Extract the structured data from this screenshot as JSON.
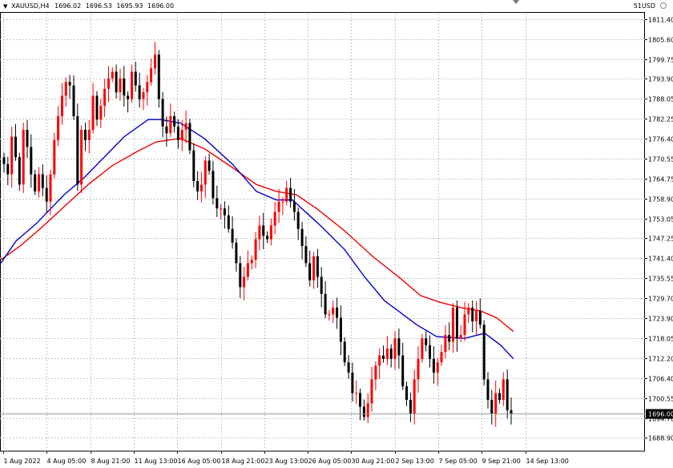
{
  "header": {
    "symbol": "XAUUSD,H4",
    "open": "1696.02",
    "high": "1696.53",
    "low": "1695.93",
    "close": "1696.00",
    "signal": "51USD"
  },
  "colors": {
    "bull": "#ff0000",
    "bear": "#000000",
    "ma_fast": "#0000cc",
    "ma_slow": "#ee0000",
    "grid": "#c8c8c8",
    "price_tag_bg": "#000000",
    "price_tag_fg": "#ffffff"
  },
  "chart_data": {
    "type": "candlestick",
    "timeframe": "H4",
    "ylim": [
      1685,
      1813
    ],
    "grid": true,
    "price_ticks": [
      "1811.40",
      "1805.60",
      "1799.75",
      "1793.90",
      "1788.05",
      "1782.25",
      "1776.40",
      "1770.55",
      "1764.75",
      "1758.90",
      "1753.05",
      "1747.25",
      "1741.40",
      "1735.55",
      "1729.70",
      "1723.90",
      "1718.05",
      "1712.20",
      "1706.40",
      "1700.55",
      "1694.70",
      "1688.90"
    ],
    "time_labels": [
      "1 Aug 2022",
      "4 Aug 05:00",
      "8 Aug 21:00",
      "11 Aug 13:00",
      "16 Aug 05:00",
      "18 Aug 21:00",
      "23 Aug 13:00",
      "26 Aug 05:00",
      "30 Aug 21:00",
      "2 Sep 13:00",
      "7 Sep 05:00",
      "9 Sep 21:00",
      "14 Sep 13:00"
    ],
    "current_price": "1696.00",
    "closes": [
      1769,
      1766,
      1777,
      1771,
      1763,
      1779,
      1774,
      1766,
      1761,
      1766,
      1762,
      1758,
      1766,
      1776,
      1783,
      1789,
      1793,
      1792,
      1783,
      1763,
      1779,
      1776,
      1779,
      1789,
      1782,
      1786,
      1791,
      1794,
      1796,
      1790,
      1794,
      1789,
      1788,
      1796,
      1792,
      1788,
      1790,
      1793,
      1797,
      1801,
      1788,
      1780,
      1778,
      1783,
      1780,
      1776,
      1779,
      1781,
      1773,
      1764,
      1761,
      1763,
      1770,
      1767,
      1759,
      1756,
      1756,
      1754,
      1750,
      1746,
      1740,
      1733,
      1736,
      1740,
      1741,
      1747,
      1751,
      1748,
      1747,
      1751,
      1755,
      1758,
      1758,
      1762,
      1758,
      1755,
      1750,
      1745,
      1740,
      1735,
      1742,
      1736,
      1731,
      1725,
      1725,
      1727,
      1724,
      1717,
      1711,
      1708,
      1702,
      1702,
      1698,
      1695,
      1699,
      1706,
      1710,
      1713,
      1712,
      1715,
      1712,
      1718,
      1713,
      1704,
      1700,
      1696,
      1706,
      1712,
      1718,
      1716,
      1712,
      1708,
      1711,
      1714,
      1719,
      1717,
      1727,
      1718,
      1719,
      1725,
      1727,
      1723,
      1726,
      1722,
      1706,
      1700,
      1696,
      1702,
      1700,
      1706,
      1697,
      1696
    ],
    "ma_fast": [
      {
        "x": 1,
        "y": 1740
      },
      {
        "x": 20,
        "y": 1746.5
      },
      {
        "x": 45,
        "y": 1751.5
      },
      {
        "x": 80,
        "y": 1760
      },
      {
        "x": 105,
        "y": 1765
      },
      {
        "x": 130,
        "y": 1771
      },
      {
        "x": 155,
        "y": 1777
      },
      {
        "x": 185,
        "y": 1782
      },
      {
        "x": 200,
        "y": 1782
      },
      {
        "x": 225,
        "y": 1781
      },
      {
        "x": 255,
        "y": 1776.5
      },
      {
        "x": 290,
        "y": 1769
      },
      {
        "x": 320,
        "y": 1761
      },
      {
        "x": 345,
        "y": 1758.5
      },
      {
        "x": 365,
        "y": 1758.5
      },
      {
        "x": 400,
        "y": 1751
      },
      {
        "x": 430,
        "y": 1744
      },
      {
        "x": 455,
        "y": 1736
      },
      {
        "x": 480,
        "y": 1729
      },
      {
        "x": 500,
        "y": 1725.5
      },
      {
        "x": 520,
        "y": 1722
      },
      {
        "x": 545,
        "y": 1718.5
      },
      {
        "x": 580,
        "y": 1718
      },
      {
        "x": 605,
        "y": 1719.5
      },
      {
        "x": 625,
        "y": 1716
      },
      {
        "x": 641,
        "y": 1712
      }
    ],
    "ma_slow": [
      {
        "x": 1,
        "y": 1741
      },
      {
        "x": 25,
        "y": 1745
      },
      {
        "x": 50,
        "y": 1750
      },
      {
        "x": 80,
        "y": 1756.5
      },
      {
        "x": 110,
        "y": 1763
      },
      {
        "x": 140,
        "y": 1768.5
      },
      {
        "x": 170,
        "y": 1772.5
      },
      {
        "x": 195,
        "y": 1775.5
      },
      {
        "x": 225,
        "y": 1776.5
      },
      {
        "x": 255,
        "y": 1773.5
      },
      {
        "x": 290,
        "y": 1768
      },
      {
        "x": 320,
        "y": 1763
      },
      {
        "x": 345,
        "y": 1761
      },
      {
        "x": 370,
        "y": 1760
      },
      {
        "x": 395,
        "y": 1756
      },
      {
        "x": 430,
        "y": 1749.5
      },
      {
        "x": 465,
        "y": 1742
      },
      {
        "x": 500,
        "y": 1735.5
      },
      {
        "x": 525,
        "y": 1730.5
      },
      {
        "x": 550,
        "y": 1728.5
      },
      {
        "x": 575,
        "y": 1727
      },
      {
        "x": 600,
        "y": 1726
      },
      {
        "x": 620,
        "y": 1724
      },
      {
        "x": 641,
        "y": 1720
      }
    ]
  }
}
